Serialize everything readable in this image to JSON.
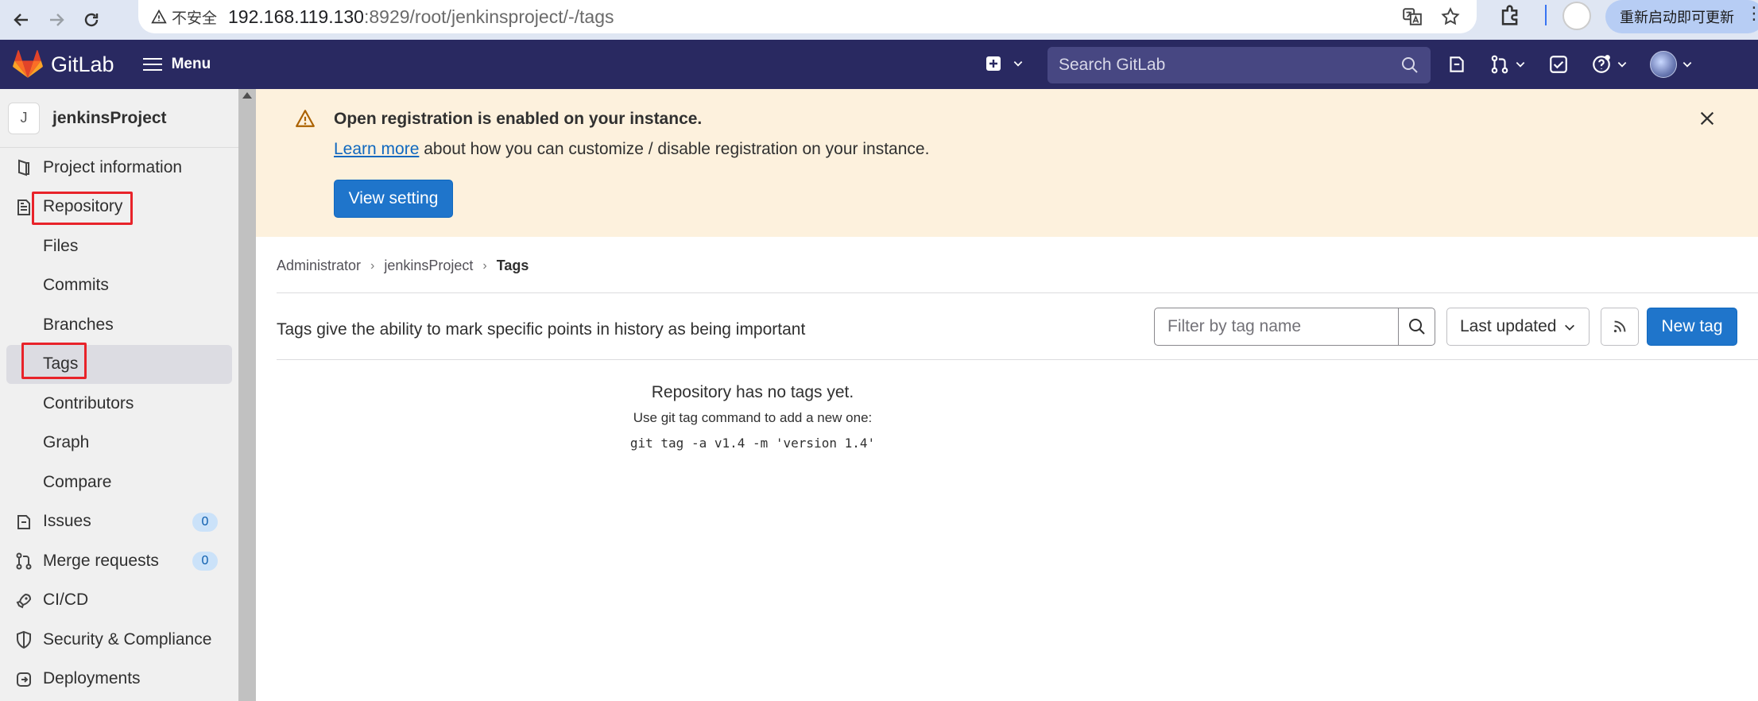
{
  "browser": {
    "security_label": "不安全",
    "url_host": "192.168.119.130",
    "url_rest": ":8929/root/jenkinsproject/-/tags",
    "update_label": "重新启动即可更新"
  },
  "topbar": {
    "brand": "GitLab",
    "menu_label": "Menu",
    "search_placeholder": "Search GitLab"
  },
  "sidebar": {
    "project_initial": "J",
    "project_name": "jenkinsProject",
    "items": [
      {
        "label": "Project information",
        "icon": "project-info-icon"
      },
      {
        "label": "Repository",
        "icon": "repository-icon"
      },
      {
        "label": "Files"
      },
      {
        "label": "Commits"
      },
      {
        "label": "Branches"
      },
      {
        "label": "Tags"
      },
      {
        "label": "Contributors"
      },
      {
        "label": "Graph"
      },
      {
        "label": "Compare"
      },
      {
        "label": "Issues",
        "icon": "issues-icon",
        "count": "0"
      },
      {
        "label": "Merge requests",
        "icon": "merge-request-icon",
        "count": "0"
      },
      {
        "label": "CI/CD",
        "icon": "rocket-icon"
      },
      {
        "label": "Security & Compliance",
        "icon": "shield-icon"
      },
      {
        "label": "Deployments",
        "icon": "deployments-icon"
      }
    ]
  },
  "banner": {
    "title": "Open registration is enabled on your instance.",
    "link_text": "Learn more",
    "text_rest": " about how you can customize / disable registration on your instance.",
    "button_label": "View setting"
  },
  "breadcrumb": {
    "items": [
      "Administrator",
      "jenkinsProject",
      "Tags"
    ]
  },
  "tags": {
    "description": "Tags give the ability to mark specific points in history as being important",
    "filter_placeholder": "Filter by tag name",
    "sort_label": "Last updated",
    "new_tag_label": "New tag",
    "empty_title": "Repository has no tags yet.",
    "empty_sub": "Use git tag command to add a new one:",
    "empty_code": "git tag -a v1.4 -m 'version 1.4'"
  },
  "colors": {
    "topbar": "#292961",
    "primary": "#1f75cb",
    "banner": "#fdf1dd",
    "highlight": "#e8232a"
  }
}
